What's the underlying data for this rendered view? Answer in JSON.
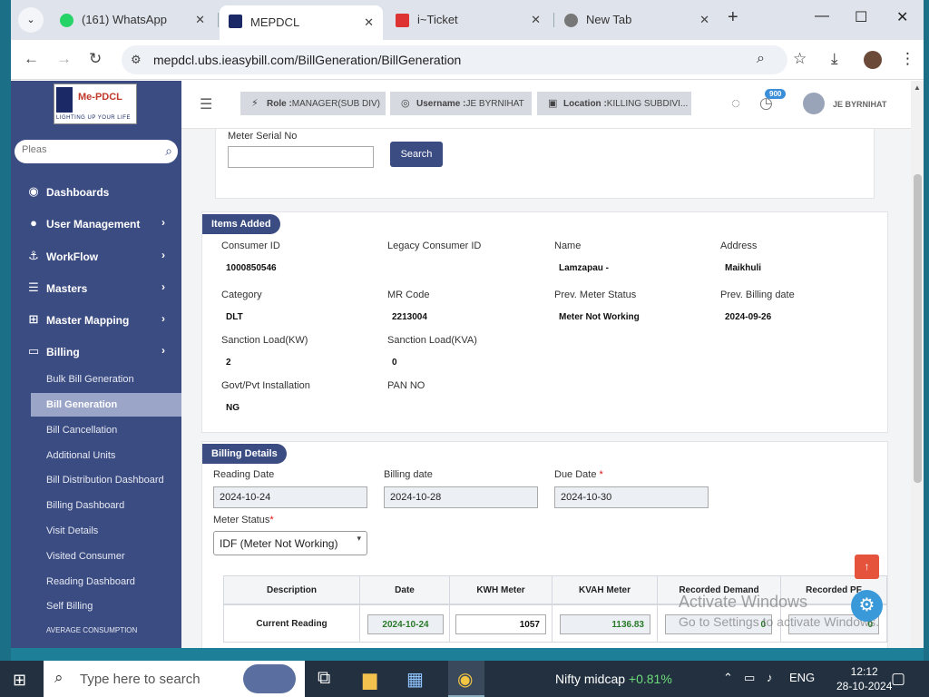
{
  "browser": {
    "tabs": [
      {
        "label": "(161) WhatsApp",
        "icon": "whatsapp-icon"
      },
      {
        "label": "MEPDCL",
        "icon": "mepdcl-favicon",
        "active": true
      },
      {
        "label": "i~Ticket",
        "icon": "iticket-icon"
      },
      {
        "label": "New Tab",
        "icon": "chrome-icon"
      }
    ],
    "url": "mepdcl.ubs.ieasybill.com/BillGeneration/BillGeneration"
  },
  "sidebar": {
    "logo_text": "Me-PDCL",
    "logo_tagline": "LIGHTING UP YOUR LIFE",
    "search_placeholder": "Pleas",
    "menu": [
      {
        "label": "Dashboards",
        "icon": "palette-icon"
      },
      {
        "label": "User Management",
        "icon": "user-icon"
      },
      {
        "label": "WorkFlow",
        "icon": "anchor-icon"
      },
      {
        "label": "Masters",
        "icon": "list-icon"
      },
      {
        "label": "Master Mapping",
        "icon": "sitemap-icon"
      },
      {
        "label": "Billing",
        "icon": "monitor-icon"
      }
    ],
    "submenu": [
      "Bulk Bill Generation",
      "Bill Generation",
      "Bill Cancellation",
      "Additional Units",
      "Bill Distribution Dashboard",
      "Billing Dashboard",
      "Visit Details",
      "Visited Consumer",
      "Reading Dashboard",
      "Self Billing",
      "AVERAGE CONSUMPTION"
    ]
  },
  "header": {
    "role_key": "Role :",
    "role": "MANAGER(SUB DIV)",
    "username_key": "Username :",
    "username": "JE BYRNIHAT",
    "location_key": "Location :",
    "location": "KILLING SUBDIVI...",
    "notif_count": "900",
    "user": "JE BYRNIHAT"
  },
  "search": {
    "label": "Meter Serial No",
    "value": "",
    "button": "Search"
  },
  "items": {
    "title": "Items Added",
    "fields": [
      {
        "label": "Consumer ID",
        "value": "1000850546"
      },
      {
        "label": "Legacy Consumer ID",
        "value": ""
      },
      {
        "label": "Name",
        "value": "Lamzapau -"
      },
      {
        "label": "Address",
        "value": "Maikhuli"
      },
      {
        "label": "Category",
        "value": "DLT"
      },
      {
        "label": "MR Code",
        "value": "2213004"
      },
      {
        "label": "Prev. Meter Status",
        "value": "Meter Not Working"
      },
      {
        "label": "Prev. Billing date",
        "value": "2024-09-26"
      },
      {
        "label": "Sanction Load(KW)",
        "value": "2"
      },
      {
        "label": "Sanction Load(KVA)",
        "value": "0"
      },
      {
        "label": "Govt/Pvt Installation",
        "value": "NG"
      },
      {
        "label": "PAN NO",
        "value": ""
      }
    ]
  },
  "billing": {
    "title": "Billing Details",
    "reading_date_label": "Reading Date",
    "reading_date": "2024-10-24",
    "billing_date_label": "Billing date",
    "billing_date": "2024-10-28",
    "due_date_label": "Due Date",
    "due_date": "2024-10-30",
    "meter_status_label": "Meter Status",
    "meter_status": "IDF (Meter Not Working)",
    "required_mark": "*",
    "table": {
      "headers": [
        "Description",
        "Date",
        "KWH Meter",
        "KVAH Meter",
        "Recorded Demand",
        "Recorded PF"
      ],
      "row": {
        "desc": "Current Reading",
        "date": "2024-10-24",
        "kwh": "1057",
        "kvah": "1136.83",
        "demand": "0",
        "pf": "0"
      }
    }
  },
  "watermark": {
    "line1": "Activate Windows",
    "line2": "Go to Settings to activate Windows."
  },
  "taskbar": {
    "search_placeholder": "Type here to search",
    "nifty": "Nifty midcap",
    "nifty_change": "+0.81%",
    "lang": "ENG",
    "time": "12:12",
    "date": "28-10-2024"
  },
  "colors": {
    "sidebar": "#3b4c82",
    "accent": "#3b4c82",
    "fab": "#e5533d"
  }
}
